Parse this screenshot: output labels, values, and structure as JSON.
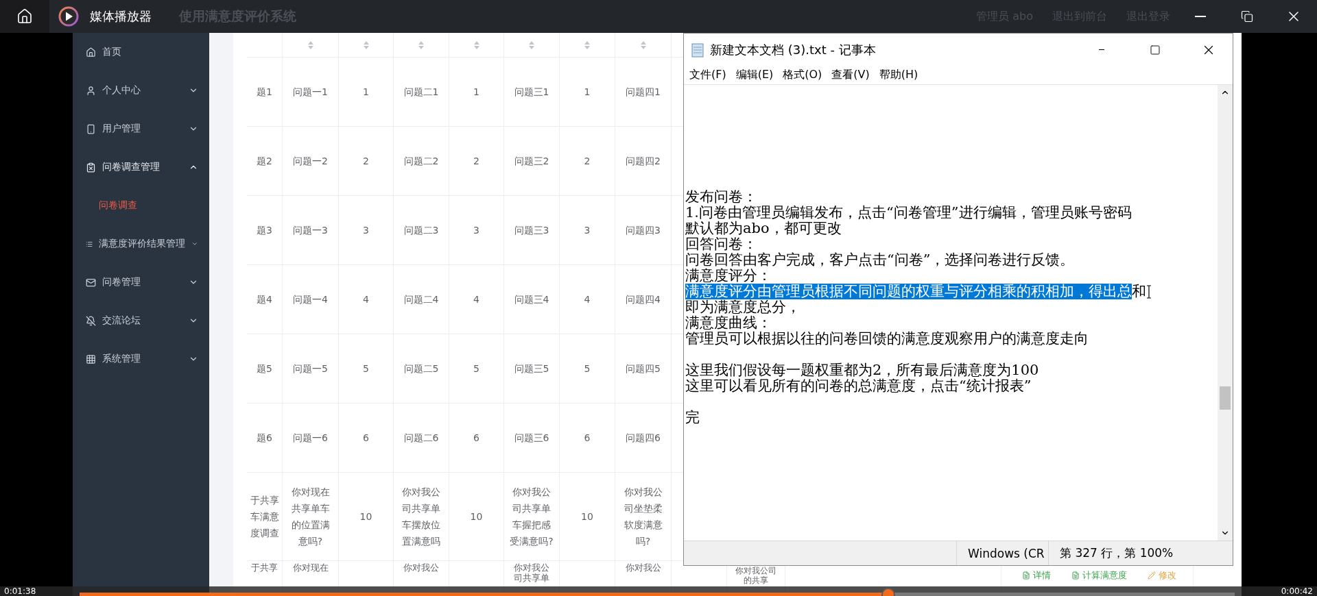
{
  "player": {
    "title": "媒体播放器",
    "time_elapsed": "0:01:38",
    "time_remaining": "0:00:42",
    "progress": {
      "level": 0.7
    }
  },
  "app": {
    "title_fragment": "使用满意度评价系统",
    "header_links": [
      "管理员 abo",
      "退出到前台",
      "退出登录"
    ],
    "sidebar": {
      "items": [
        {
          "label": "首页",
          "kind": "link",
          "selected": false
        },
        {
          "label": "个人中心",
          "kind": "group",
          "expanded": false,
          "selected": false
        },
        {
          "label": "用户管理",
          "kind": "group",
          "expanded": false,
          "selected": false
        },
        {
          "label": "问卷调查管理",
          "kind": "group",
          "expanded": true,
          "selected": false
        },
        {
          "label": "问卷调查",
          "kind": "subitem",
          "selected": true
        },
        {
          "label": "满意度评价结果管理",
          "kind": "group",
          "expanded": false,
          "selected": false
        },
        {
          "label": "问卷管理",
          "kind": "group",
          "expanded": false,
          "selected": false
        },
        {
          "label": "交流论坛",
          "kind": "group",
          "expanded": false,
          "selected": false
        },
        {
          "label": "系统管理",
          "kind": "group",
          "expanded": false,
          "selected": false
        }
      ]
    },
    "table": {
      "rows": [
        {
          "kind": "full",
          "cells": [
            "题1",
            "问题一1",
            "1",
            "问题二1",
            "1",
            "问题三1",
            "1",
            "问题四1"
          ]
        },
        {
          "kind": "full",
          "cells": [
            "题2",
            "问题一2",
            "2",
            "问题二2",
            "2",
            "问题三2",
            "2",
            "问题四2"
          ]
        },
        {
          "kind": "full",
          "cells": [
            "题3",
            "问题一3",
            "3",
            "问题二3",
            "3",
            "问题三3",
            "3",
            "问题四3"
          ]
        },
        {
          "kind": "full",
          "cells": [
            "题4",
            "问题一4",
            "4",
            "问题二4",
            "4",
            "问题三4",
            "4",
            "问题四4"
          ]
        },
        {
          "kind": "full",
          "cells": [
            "题5",
            "问题一5",
            "5",
            "问题二5",
            "5",
            "问题三5",
            "5",
            "问题四5"
          ]
        },
        {
          "kind": "full",
          "cells": [
            "题6",
            "问题一6",
            "6",
            "问题二6",
            "6",
            "问题三6",
            "6",
            "问题四6"
          ]
        },
        {
          "kind": "full",
          "cells": [
            "于共享车满意度调查",
            "你对现在共享单车的位置满意吗?",
            "10",
            "你对我公司共享单车摆放位置满意吗",
            "10",
            "你对我公司共享单车握把感受满意吗?",
            "10",
            "你对我公司坐垫柔软度满意吗?"
          ]
        },
        {
          "kind": "partial",
          "cells": [
            "于共享",
            "你对现在",
            null,
            "你对我公",
            null,
            "你对我公司共享单",
            null,
            "你对我公"
          ],
          "extra_cell": "你对我公司的共享",
          "actions": [
            {
              "label": "详情",
              "kind": "view"
            },
            {
              "label": "计算满意度",
              "kind": "calc"
            },
            {
              "label": "修改",
              "kind": "edit"
            }
          ]
        }
      ]
    }
  },
  "notepad": {
    "title": "新建文本文档 (3).txt - 记事本",
    "menu": [
      "文件(F)",
      "编辑(E)",
      "格式(O)",
      "查看(V)",
      "帮助(H)"
    ],
    "lines": [
      {
        "kind": "text",
        "segments": [
          {
            "text": "发布问卷：",
            "selected": false
          }
        ]
      },
      {
        "kind": "text",
        "segments": [
          {
            "text": "1.问卷由管理员编辑发布，点击“问卷管理”进行编辑，管理员账号密码",
            "selected": false
          }
        ]
      },
      {
        "kind": "text",
        "segments": [
          {
            "text": "默认都为abo，都可更改",
            "selected": false
          }
        ]
      },
      {
        "kind": "text",
        "segments": [
          {
            "text": "回答问卷：",
            "selected": false
          }
        ]
      },
      {
        "kind": "text",
        "segments": [
          {
            "text": "问卷回答由客户完成，客户点击“问卷”，选择问卷进行反馈。",
            "selected": false
          }
        ]
      },
      {
        "kind": "text",
        "segments": [
          {
            "text": "满意度评分：",
            "selected": false
          }
        ]
      },
      {
        "kind": "text",
        "segments": [
          {
            "text": "满意度评分由管理员根据不同问题的权重与评分相乘的积相加，得出总",
            "selected": true
          },
          {
            "text": "和",
            "selected": false
          }
        ]
      },
      {
        "kind": "text",
        "segments": [
          {
            "text": "即为满意度总分，",
            "selected": false
          }
        ]
      },
      {
        "kind": "text",
        "segments": [
          {
            "text": "满意度曲线：",
            "selected": false
          }
        ]
      },
      {
        "kind": "text",
        "segments": [
          {
            "text": "管理员可以根据以往的问卷回馈的满意度观察用户的满意度走向",
            "selected": false
          }
        ]
      },
      {
        "kind": "blank"
      },
      {
        "kind": "text",
        "segments": [
          {
            "text": "这里我们假设每一题权重都为2，所有最后满意度为100",
            "selected": false
          }
        ]
      },
      {
        "kind": "text",
        "segments": [
          {
            "text": "这里可以看见所有的问卷的总满意度，点击“统计报表”",
            "selected": false
          }
        ]
      },
      {
        "kind": "blank"
      },
      {
        "kind": "text",
        "segments": [
          {
            "text": "完",
            "selected": false
          }
        ]
      }
    ],
    "status": [
      "Windows (CR",
      "第 327 行，第 100%"
    ]
  }
}
